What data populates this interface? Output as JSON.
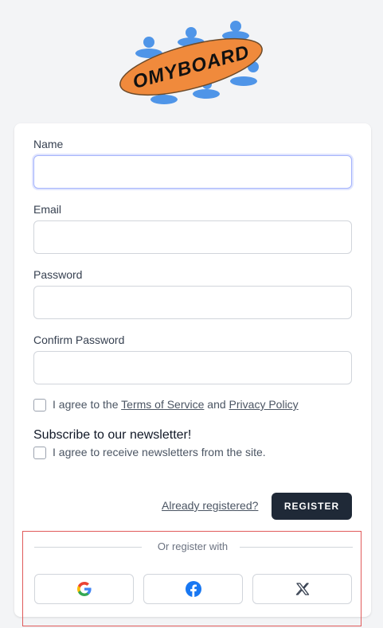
{
  "logo": {
    "text": "OMYBOARD"
  },
  "form": {
    "name_label": "Name",
    "email_label": "Email",
    "password_label": "Password",
    "confirm_password_label": "Confirm Password",
    "name_value": "",
    "email_value": "",
    "password_value": "",
    "confirm_password_value": ""
  },
  "terms": {
    "prefix": "I agree to the",
    "terms_link": "Terms of Service",
    "and": "and",
    "privacy_link": "Privacy Policy"
  },
  "newsletter": {
    "title": "Subscribe to our newsletter!",
    "agree_text": "I agree to receive newsletters from the site."
  },
  "actions": {
    "already_registered": "Already registered?",
    "register_label": "REGISTER"
  },
  "social": {
    "divider_text": "Or register with",
    "providers": [
      "google-icon",
      "facebook-icon",
      "x-icon"
    ]
  }
}
